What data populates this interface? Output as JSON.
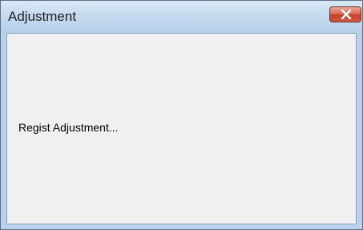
{
  "window": {
    "title": "Adjustment",
    "close_icon": "close-icon",
    "accent_close": "#d8664f"
  },
  "dialog": {
    "message": "Regist Adjustment..."
  }
}
